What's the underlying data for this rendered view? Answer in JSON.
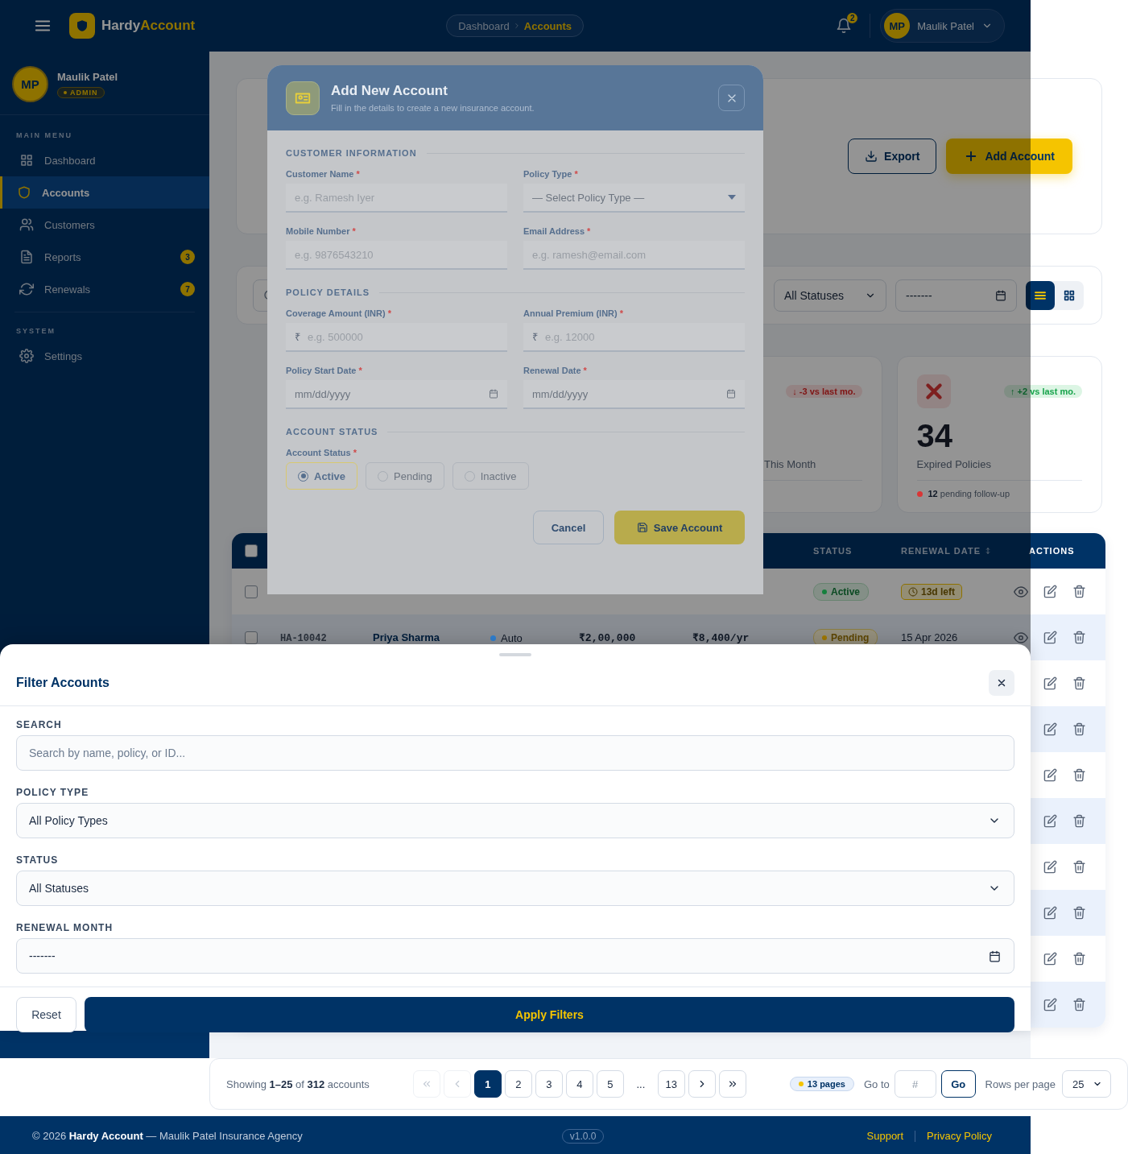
{
  "header": {
    "brand": {
      "first": "Hardy",
      "second": "Account"
    },
    "breadcrumb": [
      {
        "label": "Dashboard",
        "current": false
      },
      {
        "label": "Accounts",
        "current": true
      }
    ],
    "notifications": "2",
    "user": {
      "initials": "MP",
      "name": "Maulik Patel"
    }
  },
  "sidebar": {
    "profile": {
      "initials": "MP",
      "name": "Maulik Patel",
      "role": "ADMIN"
    },
    "sections": [
      {
        "title": "MAIN MENU",
        "items": [
          {
            "label": "Dashboard",
            "selected": false
          },
          {
            "label": "Accounts",
            "selected": true
          },
          {
            "label": "Customers",
            "selected": false
          },
          {
            "label": "Reports",
            "selected": false,
            "badge": "3"
          },
          {
            "label": "Renewals",
            "selected": false,
            "badge": "7"
          }
        ]
      },
      {
        "title": "SYSTEM",
        "items": [
          {
            "label": "Settings",
            "selected": false
          }
        ]
      }
    ]
  },
  "page_actions": [
    {
      "label": "Export",
      "kind": "secondary"
    },
    {
      "label": "Add Account",
      "kind": "primary"
    }
  ],
  "filter_bar": {
    "status_select": "All Statuses",
    "month_field": "-------",
    "views": [
      {
        "kind": "list",
        "selected": true
      },
      {
        "kind": "grid",
        "selected": false
      }
    ]
  },
  "stats": [
    {
      "kind": "covered"
    },
    {
      "kind": "covered"
    },
    {
      "kind": "partial",
      "trend": {
        "text": "↓ -3 vs last mo.",
        "positive": false
      },
      "label": "This Month"
    },
    {
      "kind": "full",
      "trend": {
        "text": "↑ +2 vs last mo.",
        "positive": true
      },
      "value": "34",
      "label": "Expired Policies",
      "foot": "**12** pending follow-up",
      "color": "#d93636"
    }
  ],
  "table": {
    "header_checked": false,
    "columns": [
      {
        "kind": "covered"
      },
      {
        "kind": "covered"
      },
      {
        "kind": "covered"
      },
      {
        "kind": "covered"
      },
      {
        "kind": "covered"
      },
      {
        "kind": "shown",
        "label": "STATUS",
        "sortable": false
      },
      {
        "kind": "shown",
        "label": "RENEWAL DATE",
        "sortable": true
      },
      {
        "kind": "shown",
        "label": "ACTIONS",
        "sortable": false
      }
    ],
    "rows": [
      {
        "kind": "partial",
        "checked": false,
        "status": {
          "label": "Active",
          "kind": "active"
        },
        "renewal": {
          "label": "13d left",
          "kind": "countdown"
        }
      },
      {
        "kind": "full",
        "checked": false,
        "account_id": "HA-10042",
        "customer": "Priya Sharma",
        "policy": {
          "label": "Auto",
          "color": "#2f7fd0"
        },
        "coverage": "₹2,00,000",
        "premium": "₹8,400/yr",
        "status": {
          "label": "Pending",
          "kind": "pending"
        },
        "renewal": {
          "label": "15 Apr 2026",
          "kind": "date"
        }
      },
      {
        "kind": "covered"
      },
      {
        "kind": "covered"
      },
      {
        "kind": "covered"
      },
      {
        "kind": "covered"
      },
      {
        "kind": "covered"
      },
      {
        "kind": "covered"
      },
      {
        "kind": "covered"
      },
      {
        "kind": "covered"
      }
    ]
  },
  "modal": {
    "title": "Add New Account",
    "subtitle": "Fill in the details to create a new insurance account.",
    "sections": [
      {
        "title": "CUSTOMER INFORMATION",
        "fields": [
          {
            "kind": "text",
            "label": "Customer Name",
            "mark": "*",
            "placeholder": "e.g. Ramesh Iyer"
          },
          {
            "kind": "select",
            "label": "Policy Type",
            "mark": "*",
            "placeholder": "— Select Policy Type —"
          },
          {
            "kind": "text",
            "label": "Mobile Number",
            "mark": "*",
            "placeholder": "e.g. 9876543210"
          },
          {
            "kind": "text",
            "label": "Email Address",
            "mark": "*",
            "placeholder": "e.g. ramesh@email.com"
          }
        ]
      },
      {
        "title": "POLICY DETAILS",
        "fields": [
          {
            "kind": "currency",
            "label": "Coverage Amount (INR)",
            "mark": "*",
            "prefix": "₹",
            "placeholder": "e.g. 500000"
          },
          {
            "kind": "currency",
            "label": "Annual Premium (INR)",
            "mark": "*",
            "prefix": "₹",
            "placeholder": "e.g. 12000"
          },
          {
            "kind": "date",
            "label": "Policy Start Date",
            "mark": "*",
            "placeholder": "mm/dd/yyyy"
          },
          {
            "kind": "date",
            "label": "Renewal Date",
            "mark": "*",
            "placeholder": "mm/dd/yyyy"
          }
        ]
      },
      {
        "title": "ACCOUNT STATUS",
        "fields": [
          {
            "kind": "radio",
            "label": "Account Status",
            "mark": "*",
            "options": [
              {
                "label": "Active",
                "selected": true
              },
              {
                "label": "Pending",
                "selected": false
              },
              {
                "label": "Inactive",
                "selected": false
              }
            ]
          }
        ]
      }
    ],
    "buttons": [
      {
        "label": "Cancel",
        "kind": "secondary"
      },
      {
        "label": "Save Account",
        "kind": "primary"
      }
    ]
  },
  "filter_sheet": {
    "title": "Filter Accounts",
    "fields": [
      {
        "kind": "text",
        "label": "SEARCH",
        "placeholder": "Search by name, policy, or ID..."
      },
      {
        "kind": "select",
        "label": "POLICY TYPE",
        "value": "All Policy Types"
      },
      {
        "kind": "select",
        "label": "STATUS",
        "value": "All Statuses"
      },
      {
        "kind": "month",
        "label": "RENEWAL MONTH",
        "value": "-------"
      }
    ],
    "buttons": [
      {
        "label": "Reset",
        "kind": "secondary"
      },
      {
        "label": "Apply Filters",
        "kind": "primary"
      }
    ]
  },
  "pagination": {
    "summary": "Showing **1–25** of **312** accounts",
    "controls": [
      {
        "kind": "first",
        "disabled": true
      },
      {
        "kind": "prev",
        "disabled": true
      },
      {
        "kind": "page",
        "label": "1",
        "selected": true
      },
      {
        "kind": "page",
        "label": "2",
        "selected": false
      },
      {
        "kind": "page",
        "label": "3",
        "selected": false
      },
      {
        "kind": "page",
        "label": "4",
        "selected": false
      },
      {
        "kind": "page",
        "label": "5",
        "selected": false
      },
      {
        "kind": "gap",
        "label": "..."
      },
      {
        "kind": "page",
        "label": "13",
        "selected": false
      },
      {
        "kind": "next",
        "disabled": false
      },
      {
        "kind": "last",
        "disabled": false
      }
    ],
    "pages_badge": "13 pages",
    "goto_label": "Go to",
    "goto_placeholder": "#",
    "go_button": "Go",
    "rows_label": "Rows per page",
    "rows_value": "25"
  },
  "footer": {
    "text": "© 2026 **Hardy Account** — Maulik Patel Insurance Agency",
    "version": "v1.0.0",
    "links": [
      "Support",
      "Privacy Policy"
    ]
  }
}
